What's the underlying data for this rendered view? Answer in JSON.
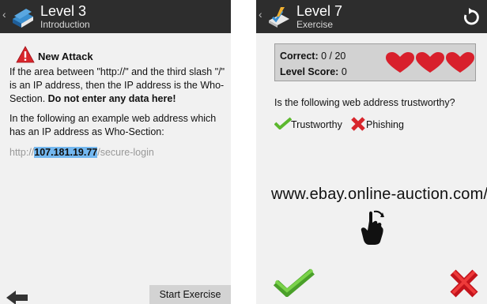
{
  "left": {
    "header": {
      "title": "Level 3",
      "subtitle": "Introduction",
      "back_chevron": "‹",
      "icon": "book-icon"
    },
    "warning": {
      "title": "New Attack",
      "icon": "warning-triangle-icon"
    },
    "paragraph1": {
      "text": "If the area between \"http://\" and the third slash \"/\" is an IP address, then the IP address is the Who-Section. ",
      "bold": "Do not enter any data here!"
    },
    "paragraph2": "In the following an example web address which has an IP address as Who-Section:",
    "example_url": {
      "prefix": "http://",
      "ip": "107.181.19.77",
      "suffix": "/secure-login"
    },
    "footer": {
      "back_icon": "left-arrow-icon",
      "start_button": "Start Exercise"
    }
  },
  "right": {
    "header": {
      "title": "Level 7",
      "subtitle": "Exercise",
      "back_chevron": "‹",
      "icon": "pencil-check-icon",
      "refresh_icon": "refresh-icon"
    },
    "score": {
      "correct_label": "Correct:",
      "correct_value": "0 / 20",
      "level_label": "Level Score:",
      "level_value": "0",
      "lives": 3
    },
    "question": "Is the following web address trustworthy?",
    "options": {
      "trust": "Trustworthy",
      "phish": "Phishing"
    },
    "url_display": "www.ebay.online-auction.com/myebay",
    "swipe_icon": "swipe-hand-icon",
    "actions": {
      "accept_icon": "big-check-icon",
      "reject_icon": "big-x-icon"
    }
  },
  "colors": {
    "header_bg": "#2d2d2d",
    "screen_bg": "#f1f1f1",
    "highlight": "#74b8f0",
    "heart": "#d8202c",
    "check": "#5cb82e",
    "cross": "#d8262c"
  }
}
